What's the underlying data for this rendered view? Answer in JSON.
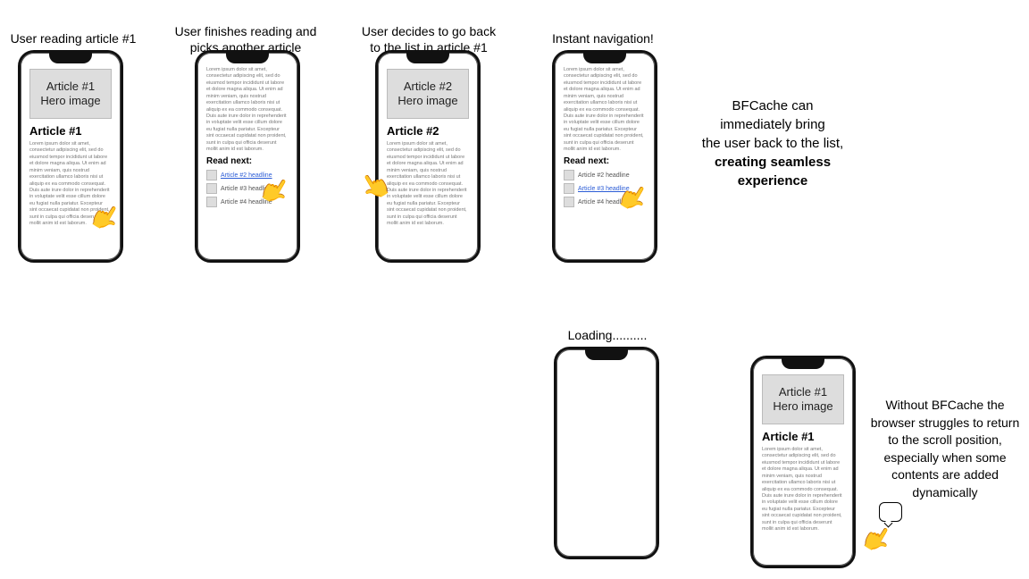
{
  "captions": {
    "c1": "User reading article #1",
    "c2": "User finishes reading and\npicks another article",
    "c3": "User decides to go back\nto the list in article #1",
    "c4": "Instant navigation!",
    "c5": "Loading.........."
  },
  "descriptions": {
    "top": {
      "line1": "BFCache can",
      "line2": "immediately bring",
      "line3": "the user back to the list,",
      "bold1": "creating seamless",
      "bold2": "experience"
    },
    "bottom": "Without BFCache the browser struggles to return to the scroll position, especially when some contents are added dynamically"
  },
  "phone": {
    "hero1": "Article #1\nHero image",
    "hero2": "Article #2\nHero image",
    "title1": "Article #1",
    "title2": "Article #2",
    "lorem": "Lorem ipsum dolor sit amet, consectetur adipiscing elit, sed do eiusmod tempor incididunt ut labore et dolore magna aliqua. Ut enim ad minim veniam, quis nostrud exercitation ullamco laboris nisi ut aliquip ex ea commodo consequat. Duis aute irure dolor in reprehenderit in voluptate velit esse cillum dolore eu fugiat nulla pariatur. Excepteur sint occaecat cupidatat non proident, sunt in culpa qui officia deserunt mollit anim id est laborum.",
    "readNext": "Read next:",
    "items": {
      "a2": "Article #2 headline",
      "a3": "Article #3 headline",
      "a4": "Article #4 headline"
    }
  }
}
